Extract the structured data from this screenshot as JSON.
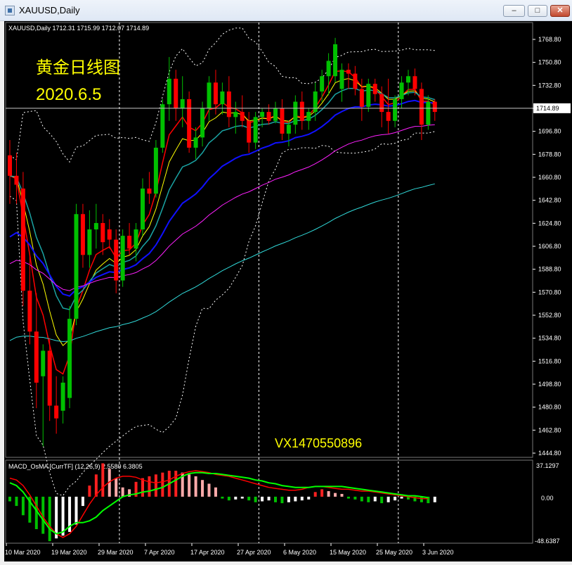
{
  "window": {
    "title": "XAUUSD,Daily",
    "buttons": {
      "minimize": "–",
      "maximize": "□",
      "close": "✕"
    }
  },
  "colors": {
    "background": "#000000",
    "up_candle": "#00c000",
    "down_candle": "#ff0000",
    "grid": "#ffffff",
    "text": "#ffffff",
    "annotation": "#ffff00",
    "ma_red": "#ff0000",
    "ma_yellow": "#ffff00",
    "ma_teal": "#1aa3a3",
    "ma_blue": "#1010ff",
    "ma_magenta": "#ff20ff",
    "ma_cyan": "#30d8d8",
    "bands": "#ffffff",
    "macd_main": "#00ff00",
    "macd_signal": "#ff0000",
    "hist_up": "#ff2020",
    "hist_down": "#00c000",
    "hist_up_light": "#ffaaaa",
    "hist_down_light": "#ffffff"
  },
  "main_panel": {
    "symbol_info": "XAUUSD,Daily  1712.31 1715.99 1712.07 1714.89",
    "annotation_title": "黄金日线图",
    "annotation_date": "2020.6.5",
    "watermark": "VX1470550896",
    "current_price": "1714.89",
    "price_axis_labels": [
      "1768.80",
      "1750.80",
      "1732.80",
      "1714.80",
      "1696.80",
      "1678.80",
      "1660.80",
      "1642.80",
      "1624.80",
      "1606.80",
      "1588.80",
      "1570.80",
      "1552.80",
      "1534.80",
      "1516.80",
      "1498.80",
      "1480.80",
      "1462.80",
      "1444.80"
    ]
  },
  "macd_panel": {
    "label": "MACD_OsMA [CurrTF] (12,26,9) 2.5580 6.3805",
    "axis_labels": [
      "37.1297",
      "0.00",
      "-48.6387"
    ]
  },
  "date_axis": [
    "10 Mar 2020",
    "19 Mar 2020",
    "29 Mar 2020",
    "7 Apr 2020",
    "17 Apr 2020",
    "27 Apr 2020",
    "6 May 2020",
    "15 May 2020",
    "25 May 2020",
    "3 Jun 2020"
  ],
  "chart_data": {
    "type": "candlestick",
    "symbol": "XAUUSD",
    "timeframe": "Daily",
    "y_range": [
      1444.8,
      1772
    ],
    "candles": [
      {
        "o": 1678,
        "h": 1690,
        "l": 1640,
        "c": 1662
      },
      {
        "o": 1662,
        "h": 1680,
        "l": 1640,
        "c": 1655
      },
      {
        "o": 1652,
        "h": 1665,
        "l": 1560,
        "c": 1572
      },
      {
        "o": 1572,
        "h": 1600,
        "l": 1530,
        "c": 1540
      },
      {
        "o": 1540,
        "h": 1570,
        "l": 1480,
        "c": 1500
      },
      {
        "o": 1505,
        "h": 1530,
        "l": 1450,
        "c": 1525
      },
      {
        "o": 1525,
        "h": 1535,
        "l": 1470,
        "c": 1482
      },
      {
        "o": 1482,
        "h": 1505,
        "l": 1460,
        "c": 1472
      },
      {
        "o": 1478,
        "h": 1505,
        "l": 1468,
        "c": 1500
      },
      {
        "o": 1488,
        "h": 1560,
        "l": 1480,
        "c": 1550
      },
      {
        "o": 1550,
        "h": 1640,
        "l": 1545,
        "c": 1632
      },
      {
        "o": 1632,
        "h": 1640,
        "l": 1590,
        "c": 1600
      },
      {
        "o": 1600,
        "h": 1635,
        "l": 1590,
        "c": 1620
      },
      {
        "o": 1620,
        "h": 1640,
        "l": 1605,
        "c": 1625
      },
      {
        "o": 1625,
        "h": 1632,
        "l": 1600,
        "c": 1610
      },
      {
        "o": 1620,
        "h": 1628,
        "l": 1605,
        "c": 1612
      },
      {
        "o": 1612,
        "h": 1620,
        "l": 1570,
        "c": 1580
      },
      {
        "o": 1580,
        "h": 1620,
        "l": 1575,
        "c": 1615
      },
      {
        "o": 1615,
        "h": 1625,
        "l": 1600,
        "c": 1605
      },
      {
        "o": 1605,
        "h": 1625,
        "l": 1595,
        "c": 1620
      },
      {
        "o": 1620,
        "h": 1660,
        "l": 1615,
        "c": 1652
      },
      {
        "o": 1652,
        "h": 1665,
        "l": 1640,
        "c": 1648
      },
      {
        "o": 1648,
        "h": 1690,
        "l": 1645,
        "c": 1684
      },
      {
        "o": 1684,
        "h": 1722,
        "l": 1680,
        "c": 1718
      },
      {
        "o": 1718,
        "h": 1755,
        "l": 1705,
        "c": 1738
      },
      {
        "o": 1738,
        "h": 1745,
        "l": 1705,
        "c": 1715
      },
      {
        "o": 1715,
        "h": 1740,
        "l": 1700,
        "c": 1722
      },
      {
        "o": 1722,
        "h": 1728,
        "l": 1680,
        "c": 1684
      },
      {
        "o": 1684,
        "h": 1700,
        "l": 1675,
        "c": 1692
      },
      {
        "o": 1692,
        "h": 1720,
        "l": 1685,
        "c": 1715
      },
      {
        "o": 1715,
        "h": 1740,
        "l": 1705,
        "c": 1735
      },
      {
        "o": 1735,
        "h": 1745,
        "l": 1710,
        "c": 1718
      },
      {
        "o": 1718,
        "h": 1735,
        "l": 1710,
        "c": 1728
      },
      {
        "o": 1728,
        "h": 1740,
        "l": 1700,
        "c": 1708
      },
      {
        "o": 1708,
        "h": 1720,
        "l": 1695,
        "c": 1712
      },
      {
        "o": 1712,
        "h": 1725,
        "l": 1700,
        "c": 1705
      },
      {
        "o": 1705,
        "h": 1712,
        "l": 1680,
        "c": 1688
      },
      {
        "o": 1688,
        "h": 1712,
        "l": 1683,
        "c": 1708
      },
      {
        "o": 1708,
        "h": 1715,
        "l": 1700,
        "c": 1712
      },
      {
        "o": 1712,
        "h": 1718,
        "l": 1702,
        "c": 1705
      },
      {
        "o": 1705,
        "h": 1720,
        "l": 1703,
        "c": 1715
      },
      {
        "o": 1715,
        "h": 1722,
        "l": 1690,
        "c": 1695
      },
      {
        "o": 1695,
        "h": 1705,
        "l": 1685,
        "c": 1702
      },
      {
        "o": 1702,
        "h": 1725,
        "l": 1695,
        "c": 1720
      },
      {
        "o": 1720,
        "h": 1728,
        "l": 1698,
        "c": 1705
      },
      {
        "o": 1705,
        "h": 1715,
        "l": 1698,
        "c": 1712
      },
      {
        "o": 1712,
        "h": 1735,
        "l": 1705,
        "c": 1728
      },
      {
        "o": 1728,
        "h": 1745,
        "l": 1720,
        "c": 1740
      },
      {
        "o": 1740,
        "h": 1758,
        "l": 1725,
        "c": 1752
      },
      {
        "o": 1740,
        "h": 1770,
        "l": 1735,
        "c": 1765
      },
      {
        "o": 1730,
        "h": 1750,
        "l": 1720,
        "c": 1745
      },
      {
        "o": 1745,
        "h": 1750,
        "l": 1730,
        "c": 1742
      },
      {
        "o": 1742,
        "h": 1748,
        "l": 1725,
        "c": 1730
      },
      {
        "o": 1730,
        "h": 1738,
        "l": 1705,
        "c": 1716
      },
      {
        "o": 1716,
        "h": 1738,
        "l": 1712,
        "c": 1734
      },
      {
        "o": 1734,
        "h": 1738,
        "l": 1720,
        "c": 1726
      },
      {
        "o": 1726,
        "h": 1732,
        "l": 1700,
        "c": 1712
      },
      {
        "o": 1712,
        "h": 1738,
        "l": 1695,
        "c": 1705
      },
      {
        "o": 1705,
        "h": 1725,
        "l": 1700,
        "c": 1722
      },
      {
        "o": 1722,
        "h": 1740,
        "l": 1715,
        "c": 1735
      },
      {
        "o": 1735,
        "h": 1745,
        "l": 1725,
        "c": 1740
      },
      {
        "o": 1740,
        "h": 1746,
        "l": 1725,
        "c": 1730
      },
      {
        "o": 1730,
        "h": 1735,
        "l": 1690,
        "c": 1702
      },
      {
        "o": 1702,
        "h": 1725,
        "l": 1698,
        "c": 1720
      },
      {
        "o": 1720,
        "h": 1722,
        "l": 1705,
        "c": 1712
      }
    ],
    "macd_histogram": [
      -5,
      -10,
      -20,
      -28,
      -35,
      -40,
      -48,
      -45,
      -42,
      -38,
      -30,
      -10,
      12,
      24,
      36,
      30,
      20,
      10,
      8,
      16,
      20,
      22,
      24,
      26,
      28,
      28,
      26,
      24,
      22,
      18,
      14,
      10,
      -2,
      -4,
      -3,
      -2,
      -4,
      -6,
      -5,
      -4,
      -6,
      -7,
      -6,
      -5,
      -4,
      -3,
      5,
      8,
      6,
      4,
      3,
      -2,
      -3,
      -5,
      -6,
      -5,
      -7,
      -6,
      -4,
      -2,
      -3,
      -5,
      -6,
      -7,
      -6
    ],
    "macd_main": [
      15,
      12,
      5,
      -5,
      -15,
      -25,
      -35,
      -40,
      -38,
      -32,
      -28,
      -28,
      -26,
      -22,
      -15,
      -10,
      -5,
      0,
      2,
      3,
      5,
      6,
      8,
      10,
      14,
      18,
      22,
      25,
      26,
      26,
      25,
      25,
      24,
      23,
      22,
      21,
      20,
      18,
      17,
      15,
      14,
      12,
      11,
      10,
      10,
      10,
      11,
      11,
      11,
      11,
      11,
      10,
      9,
      8,
      7,
      6,
      5,
      4,
      3,
      2,
      1,
      1,
      0,
      -1
    ],
    "macd_signal": [
      20,
      18,
      12,
      2,
      -10,
      -22,
      -32,
      -40,
      -44,
      -40,
      -32,
      -20,
      -8,
      2,
      10,
      16,
      20,
      22,
      22,
      21,
      18,
      16,
      15,
      16,
      18,
      22,
      25,
      27,
      28,
      27,
      26,
      24,
      23,
      22,
      20,
      18,
      16,
      14,
      12,
      10,
      9,
      8,
      7,
      7,
      8,
      10,
      11,
      11,
      10,
      9,
      8,
      8,
      7,
      6,
      6,
      5,
      4,
      3,
      2,
      1,
      0,
      -1,
      -2,
      -2
    ]
  }
}
